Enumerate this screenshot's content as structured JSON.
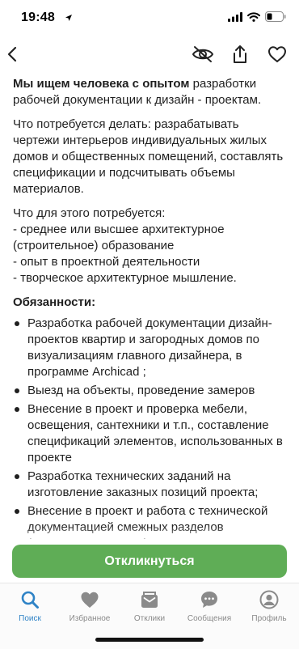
{
  "status_bar": {
    "time": "19:48"
  },
  "top_bar": {},
  "vacancy": {
    "intro_bold": "Мы ищем человека с опытом",
    "intro_rest": " разработки рабочей документации к дизайн - проектам.",
    "tasks_text": "Что потребуется делать: разрабатывать чертежи интерьеров индивидуальных жилых домов и общественных помещений, составлять спецификации и подсчитывать объемы материалов.",
    "req_line1": "Что для этого потребуется:",
    "req_line2": "- среднее или высшее архитектурное (строительное) образование",
    "req_line3": "- опыт в проектной деятельности",
    "req_line4": "- творческое архитектурное мышление.",
    "resp_title": "Обязанности:",
    "responsibilities": [
      "Разработка рабочей документации дизайн-проектов квартир и загородных домов по визуализациям главного дизайнера, в программе Archicad ;",
      "Выезд на объекты, проведение замеров",
      "Внесение в проект и проверка мебели, освещения, сантехники и т.п., составление спецификаций элементов, использованных в проекте",
      "Разработка технических заданий на изготовление заказных позиций проекта;",
      "Внесение в проект и работа с технической документацией смежных разделов (вентиляция, ОВ, ВК)"
    ]
  },
  "apply_button": {
    "label": "Откликнуться",
    "color": "#5fad56"
  },
  "tab_bar": {
    "active_color": "#2f83c6",
    "tabs": [
      {
        "label": "Поиск",
        "icon": "search-icon",
        "active": true
      },
      {
        "label": "Избранное",
        "icon": "heart-icon",
        "active": false
      },
      {
        "label": "Отклики",
        "icon": "responses-icon",
        "active": false
      },
      {
        "label": "Сообщения",
        "icon": "chat-icon",
        "active": false
      },
      {
        "label": "Профиль",
        "icon": "profile-icon",
        "active": false
      }
    ]
  }
}
